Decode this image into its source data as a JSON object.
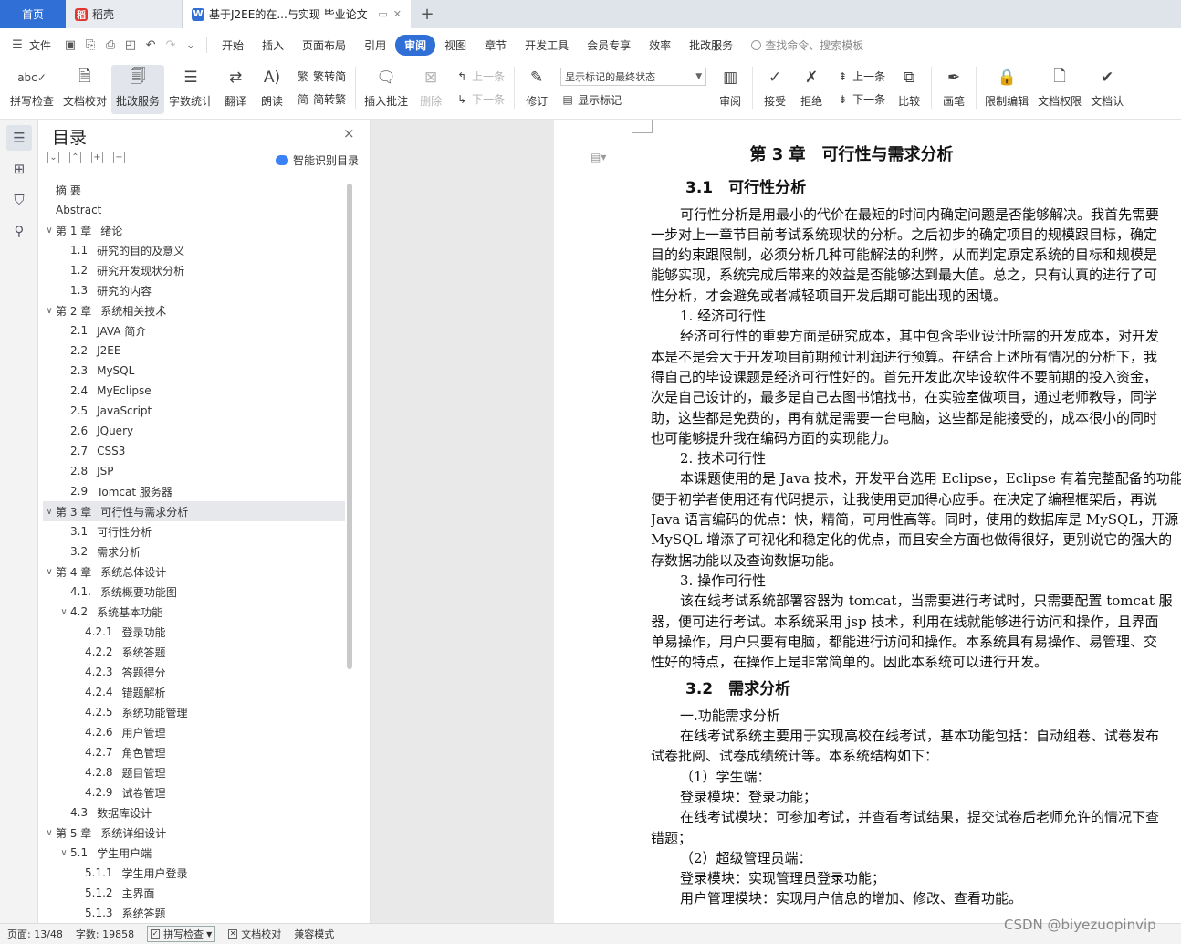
{
  "tabs": {
    "home": "首页",
    "daoke": "稻壳",
    "doc_title": "基于J2EE的在...与实现 毕业论文",
    "add": "+"
  },
  "menubar": {
    "file": "文件",
    "items": [
      "开始",
      "插入",
      "页面布局",
      "引用",
      "审阅",
      "视图",
      "章节",
      "开发工具",
      "会员专享",
      "效率",
      "批改服务"
    ],
    "active_index": 4,
    "search": "查找命令、搜索模板"
  },
  "ribbon": {
    "spellcheck": "拼写检查",
    "doc_check": "文档校对",
    "review_service": "批改服务",
    "word_count": "字数统计",
    "translate": "翻译",
    "read_aloud": "朗读",
    "trad": "繁转简",
    "simp": "简转繁",
    "insert_comment": "插入批注",
    "delete": "删除",
    "prev": "上一条",
    "next": "下一条",
    "track": "修订",
    "markup_select": "显示标记的最终状态",
    "show_markup": "显示标记",
    "review": "审阅",
    "accept": "接受",
    "reject": "拒绝",
    "prev2": "上一条",
    "next2": "下一条",
    "compare": "比较",
    "pen": "画笔",
    "restrict": "限制编辑",
    "doc_rights": "文档权限",
    "doc_cert": "文档认"
  },
  "toc": {
    "title": "目录",
    "close": "×",
    "smart": "智能识别目录",
    "items": [
      {
        "level": 0,
        "num": "",
        "text": "摘  要",
        "arrow": ""
      },
      {
        "level": 0,
        "num": "",
        "text": "Abstract",
        "arrow": ""
      },
      {
        "level": 0,
        "num": "第 1 章",
        "text": "绪论",
        "arrow": "v"
      },
      {
        "level": 1,
        "num": "1.1",
        "text": "研究的目的及意义",
        "arrow": ""
      },
      {
        "level": 1,
        "num": "1.2",
        "text": "研究开发现状分析",
        "arrow": ""
      },
      {
        "level": 1,
        "num": "1.3",
        "text": "研究的内容",
        "arrow": ""
      },
      {
        "level": 0,
        "num": "第 2 章",
        "text": "系统相关技术",
        "arrow": "v"
      },
      {
        "level": 1,
        "num": "2.1",
        "text": "JAVA 简介",
        "arrow": ""
      },
      {
        "level": 1,
        "num": "2.2",
        "text": "J2EE",
        "arrow": ""
      },
      {
        "level": 1,
        "num": "2.3",
        "text": "MySQL",
        "arrow": ""
      },
      {
        "level": 1,
        "num": "2.4",
        "text": "MyEclipse",
        "arrow": ""
      },
      {
        "level": 1,
        "num": "2.5",
        "text": "JavaScript",
        "arrow": ""
      },
      {
        "level": 1,
        "num": "2.6",
        "text": "JQuery",
        "arrow": ""
      },
      {
        "level": 1,
        "num": "2.7",
        "text": "CSS3",
        "arrow": ""
      },
      {
        "level": 1,
        "num": "2.8",
        "text": "JSP",
        "arrow": ""
      },
      {
        "level": 1,
        "num": "2.9",
        "text": "Tomcat 服务器",
        "arrow": ""
      },
      {
        "level": 0,
        "num": "第 3 章",
        "text": "可行性与需求分析",
        "arrow": "v",
        "selected": true
      },
      {
        "level": 1,
        "num": "3.1",
        "text": "可行性分析",
        "arrow": ""
      },
      {
        "level": 1,
        "num": "3.2",
        "text": "需求分析",
        "arrow": ""
      },
      {
        "level": 0,
        "num": "第 4 章",
        "text": "系统总体设计",
        "arrow": "v"
      },
      {
        "level": 1,
        "num": "4.1.",
        "text": "系统概要功能图",
        "arrow": ""
      },
      {
        "level": 1,
        "num": "4.2",
        "text": "系统基本功能",
        "arrow": "v"
      },
      {
        "level": 2,
        "num": "4.2.1",
        "text": "登录功能",
        "arrow": ""
      },
      {
        "level": 2,
        "num": "4.2.2",
        "text": "系统答题",
        "arrow": ""
      },
      {
        "level": 2,
        "num": "4.2.3",
        "text": "答题得分",
        "arrow": ""
      },
      {
        "level": 2,
        "num": "4.2.4",
        "text": "错题解析",
        "arrow": ""
      },
      {
        "level": 2,
        "num": "4.2.5",
        "text": "系统功能管理",
        "arrow": ""
      },
      {
        "level": 2,
        "num": "4.2.6",
        "text": "用户管理",
        "arrow": ""
      },
      {
        "level": 2,
        "num": "4.2.7",
        "text": "角色管理",
        "arrow": ""
      },
      {
        "level": 2,
        "num": "4.2.8",
        "text": "题目管理",
        "arrow": ""
      },
      {
        "level": 2,
        "num": "4.2.9",
        "text": "试卷管理",
        "arrow": ""
      },
      {
        "level": 1,
        "num": "4.3",
        "text": "数据库设计",
        "arrow": ""
      },
      {
        "level": 0,
        "num": "第 5 章",
        "text": "系统详细设计",
        "arrow": "v"
      },
      {
        "level": 1,
        "num": "5.1",
        "text": "学生用户端",
        "arrow": "v"
      },
      {
        "level": 2,
        "num": "5.1.1",
        "text": "学生用户登录",
        "arrow": ""
      },
      {
        "level": 2,
        "num": "5.1.2",
        "text": "主界面",
        "arrow": ""
      },
      {
        "level": 2,
        "num": "5.1.3",
        "text": "系统答题",
        "arrow": ""
      }
    ]
  },
  "doc": {
    "chapter_title": "第 3 章　可行性与需求分析",
    "sec1_title": "3.1　可行性分析",
    "sec1_paras": [
      {
        "ind": true,
        "text": "可行性分析是用最小的代价在最短的时间内确定问题是否能够解决。我首先需要"
      },
      {
        "ind": false,
        "text": "一步对上一章节目前考试系统现状的分析。之后初步的确定项目的规模跟目标，确定"
      },
      {
        "ind": false,
        "text": "目的约束跟限制，必须分析几种可能解法的利弊，从而判定原定系统的目标和规模是"
      },
      {
        "ind": false,
        "text": "能够实现，系统完成后带来的效益是否能够达到最大值。总之，只有认真的进行了可"
      },
      {
        "ind": false,
        "text": "性分析，才会避免或者减轻项目开发后期可能出现的困境。"
      },
      {
        "ind": true,
        "text": "1. 经济可行性"
      },
      {
        "ind": true,
        "text": "经济可行性的重要方面是研究成本，其中包含毕业设计所需的开发成本，对开发"
      },
      {
        "ind": false,
        "text": "本是不是会大于开发项目前期预计利润进行预算。在结合上述所有情况的分析下，我"
      },
      {
        "ind": false,
        "text": "得自己的毕设课题是经济可行性好的。首先开发此次毕设软件不要前期的投入资金，"
      },
      {
        "ind": false,
        "text": "次是自己设计的，最多是自己去图书馆找书，在实验室做项目，通过老师教导，同学"
      },
      {
        "ind": false,
        "text": "助，这些都是免费的，再有就是需要一台电脑，这些都是能接受的，成本很小的同时"
      },
      {
        "ind": false,
        "text": "也可能够提升我在编码方面的实现能力。"
      },
      {
        "ind": true,
        "text": "2. 技术可行性"
      },
      {
        "ind": true,
        "text": "本课题使用的是 Java 技术，开发平台选用 Eclipse，Eclipse 有着完整配备的功能"
      },
      {
        "ind": false,
        "text": "便于初学者使用还有代码提示，让我使用更加得心应手。在决定了编程框架后，再说"
      },
      {
        "ind": false,
        "text": "Java 语言编码的优点：快，精简，可用性高等。同时，使用的数据库是 MySQL，开源"
      },
      {
        "ind": false,
        "text": "MySQL 增添了可视化和稳定化的优点，而且安全方面也做得很好，更别说它的强大的"
      },
      {
        "ind": false,
        "text": "存数据功能以及查询数据功能。"
      },
      {
        "ind": true,
        "text": "3. 操作可行性"
      },
      {
        "ind": true,
        "text": "该在线考试系统部署容器为 tomcat，当需要进行考试时，只需要配置 tomcat 服"
      },
      {
        "ind": false,
        "text": "器，便可进行考试。本系统采用 jsp 技术，利用在线就能够进行访问和操作，且界面"
      },
      {
        "ind": false,
        "text": "单易操作，用户只要有电脑，都能进行访问和操作。本系统具有易操作、易管理、交"
      },
      {
        "ind": false,
        "text": "性好的特点，在操作上是非常简单的。因此本系统可以进行开发。"
      }
    ],
    "sec2_title": "3.2　需求分析",
    "sec2_paras": [
      {
        "ind": true,
        "text": "一.功能需求分析"
      },
      {
        "ind": true,
        "text": "在线考试系统主要用于实现高校在线考试，基本功能包括：自动组卷、试卷发布"
      },
      {
        "ind": false,
        "text": "试卷批阅、试卷成绩统计等。本系统结构如下："
      },
      {
        "ind": true,
        "text": "（1）学生端："
      },
      {
        "ind": true,
        "text": "登录模块：登录功能；"
      },
      {
        "ind": true,
        "text": "在线考试模块：可参加考试，并查看考试结果，提交试卷后老师允许的情况下查"
      },
      {
        "ind": false,
        "text": "错题；"
      },
      {
        "ind": true,
        "text": "（2）超级管理员端："
      },
      {
        "ind": true,
        "text": "登录模块：实现管理员登录功能；"
      },
      {
        "ind": true,
        "text": "用户管理模块：实现用户信息的增加、修改、查看功能。"
      }
    ]
  },
  "status": {
    "page": "页面: 13/48",
    "words": "字数: 19858",
    "spell": "拼写检查",
    "proof": "文档校对",
    "compat": "兼容模式"
  },
  "watermark": "CSDN @biyezuopinvip"
}
